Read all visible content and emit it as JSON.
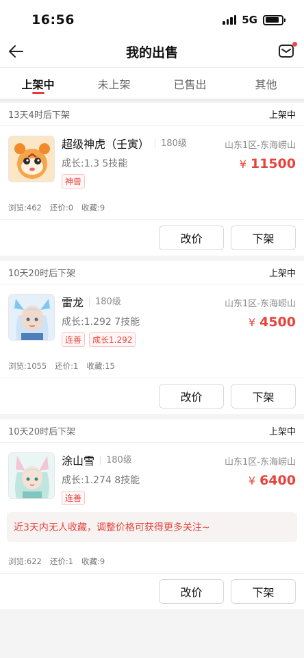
{
  "status_bar": {
    "time": "16:56",
    "network": "5G"
  },
  "header": {
    "title": "我的出售"
  },
  "tabs": [
    {
      "label": "上架中",
      "active": true
    },
    {
      "label": "未上架",
      "active": false
    },
    {
      "label": "已售出",
      "active": false
    },
    {
      "label": "其他",
      "active": false
    }
  ],
  "listings": [
    {
      "countdown": "13天4时后下架",
      "state": "上架中",
      "name": "超级神虎（壬寅）",
      "level": "180级",
      "server": "山东1区-东海崂山",
      "stats": "成长:1.3 5技能",
      "price_symbol": "¥",
      "price": "11500",
      "tags": [
        "神兽"
      ],
      "views": "浏览:462",
      "bargains": "还价:0",
      "favorites": "收藏:9",
      "edit_label": "改价",
      "delist_label": "下架"
    },
    {
      "countdown": "10天20时后下架",
      "state": "上架中",
      "name": "雷龙",
      "level": "180级",
      "server": "山东1区-东海崂山",
      "stats": "成长:1.292 7技能",
      "price_symbol": "¥",
      "price": "4500",
      "tags": [
        "连善",
        "成长1.292"
      ],
      "views": "浏览:1055",
      "bargains": "还价:1",
      "favorites": "收藏:15",
      "edit_label": "改价",
      "delist_label": "下架"
    },
    {
      "countdown": "10天20时后下架",
      "state": "上架中",
      "name": "涂山雪",
      "level": "180级",
      "server": "山东1区-东海崂山",
      "stats": "成长:1.274 8技能",
      "price_symbol": "¥",
      "price": "6400",
      "tags": [
        "连善"
      ],
      "notice": "近3天内无人收藏，调整价格可获得更多关注~",
      "views": "浏览:622",
      "bargains": "还价:1",
      "favorites": "收藏:9",
      "edit_label": "改价",
      "delist_label": "下架"
    }
  ]
}
